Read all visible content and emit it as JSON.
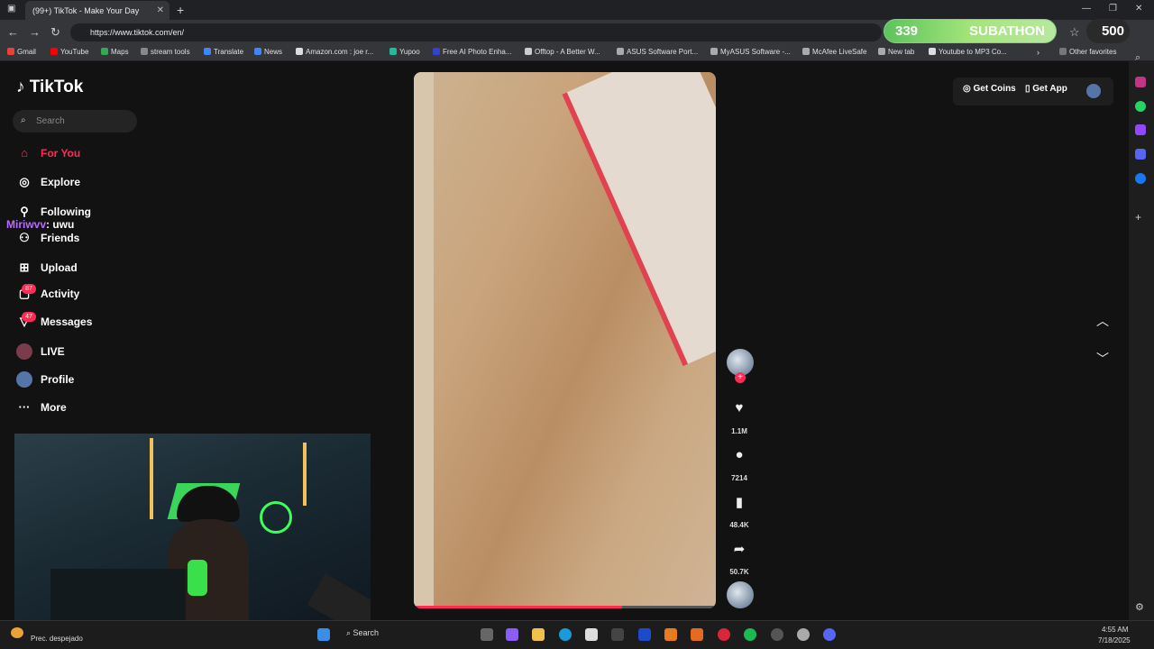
{
  "browser": {
    "tab_title": "(99+) TikTok - Make Your Day",
    "url": "https://www.tiktok.com/en/",
    "subathon_count": "339",
    "subathon_label": "SUBATHON",
    "coins": "500",
    "bookmarks": [
      "Gmail",
      "YouTube",
      "Maps",
      "stream tools",
      "Translate",
      "News",
      "Amazon.com : joe r...",
      "Yupoo",
      "Free AI Photo Enha...",
      "Offtop - A Better W...",
      "ASUS Software Port...",
      "MyASUS Software -...",
      "McAfee LiveSafe",
      "New tab",
      "Youtube to MP3 Co..."
    ],
    "other_favorites": "Other favorites"
  },
  "sidebar": {
    "logo": "TikTok",
    "search_placeholder": "Search",
    "items": [
      {
        "label": "For You",
        "icon": "home-icon"
      },
      {
        "label": "Explore",
        "icon": "compass-icon"
      },
      {
        "label": "Following",
        "icon": "following-icon"
      },
      {
        "label": "Friends",
        "icon": "friends-icon"
      },
      {
        "label": "Upload",
        "icon": "upload-icon"
      },
      {
        "label": "Activity",
        "icon": "activity-icon",
        "badge": "87"
      },
      {
        "label": "Messages",
        "icon": "messages-icon",
        "badge": "47"
      },
      {
        "label": "LIVE",
        "icon": "live-icon"
      },
      {
        "label": "Profile",
        "icon": "profile-icon"
      },
      {
        "label": "More",
        "icon": "more-icon"
      }
    ],
    "accent": "#fe2c55"
  },
  "chat": {
    "user": "Miriwvv",
    "message": ": uwu"
  },
  "header": {
    "get_coins": "Get Coins",
    "get_app": "Get App"
  },
  "video": {
    "likes": "1.1M",
    "comments": "7214",
    "saves": "48.4K",
    "shares": "50.7K",
    "progress": 0.69
  },
  "taskbar": {
    "weather": "Prec. despejado",
    "search": "Search",
    "time": "4:55 AM",
    "date": "7/18/2025"
  }
}
